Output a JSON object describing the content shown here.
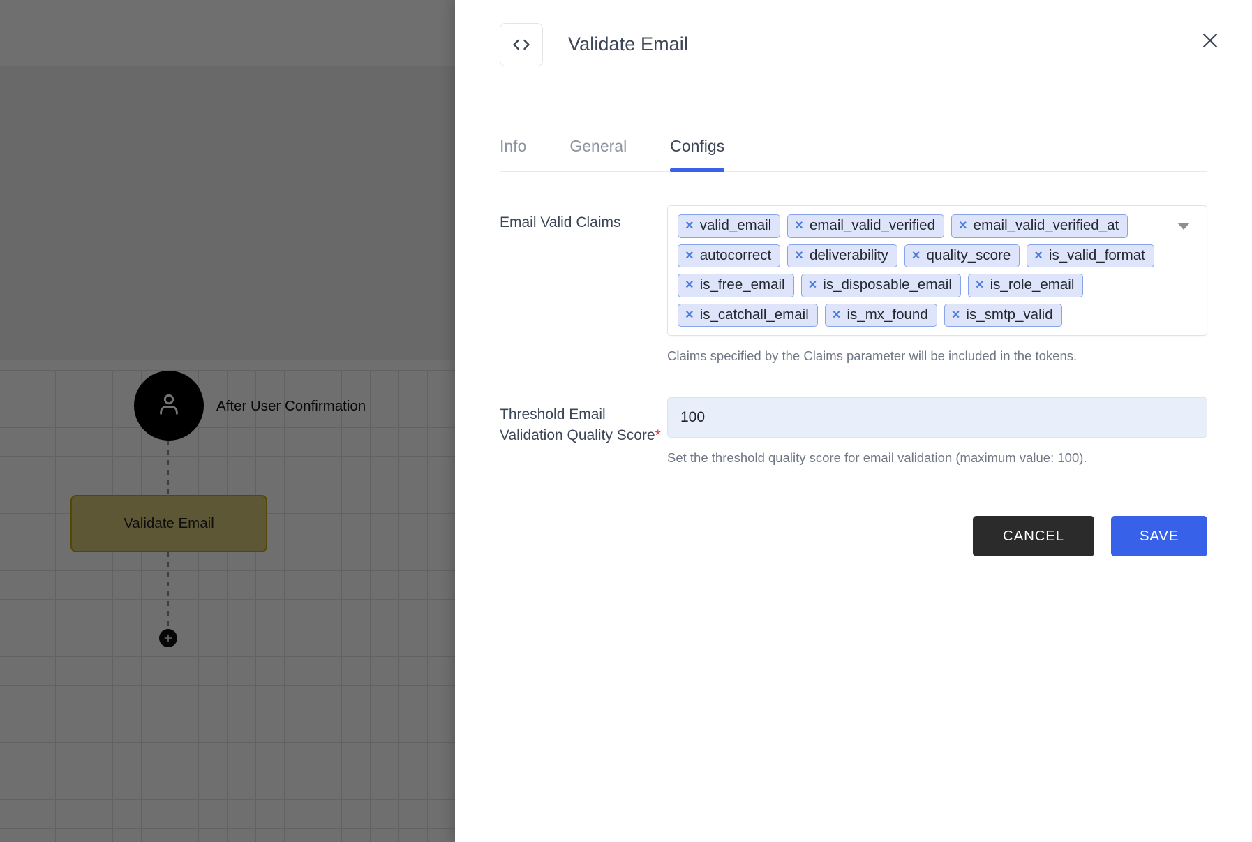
{
  "canvas": {
    "trigger_node": {
      "icon": "user-icon",
      "label": "After User Confirmation"
    },
    "flow_node": {
      "label": "Validate Email"
    },
    "add_button": {
      "icon": "plus-icon"
    }
  },
  "panel": {
    "header": {
      "icon": "code-brackets-icon",
      "title": "Validate Email",
      "close_icon": "close-icon"
    },
    "tabs": [
      {
        "label": "Info",
        "active": false
      },
      {
        "label": "General",
        "active": false
      },
      {
        "label": "Configs",
        "active": true
      }
    ],
    "fields": {
      "email_valid_claims": {
        "label": "Email Valid Claims",
        "caret_icon": "chevron-down-icon",
        "helper": "Claims specified by the Claims parameter will be included in the tokens.",
        "chips": [
          "valid_email",
          "email_valid_verified",
          "email_valid_verified_at",
          "autocorrect",
          "deliverability",
          "quality_score",
          "is_valid_format",
          "is_free_email",
          "is_disposable_email",
          "is_role_email",
          "is_catchall_email",
          "is_mx_found",
          "is_smtp_valid"
        ],
        "chip_remove_glyph": "×"
      },
      "threshold_quality_score": {
        "label": "Threshold Email Validation Quality Score",
        "required_marker": "*",
        "value": "100",
        "placeholder": "",
        "helper": "Set the threshold quality score for email validation (maximum value: 100)."
      }
    },
    "actions": {
      "cancel_label": "CANCEL",
      "save_label": "SAVE"
    }
  },
  "colors": {
    "accent_blue": "#3761e8",
    "chip_bg": "#dee5fa",
    "chip_border": "#8aa4ec",
    "cancel_black": "#2b2b2b",
    "required_red": "#d2453c",
    "node_border": "#b5a000"
  }
}
